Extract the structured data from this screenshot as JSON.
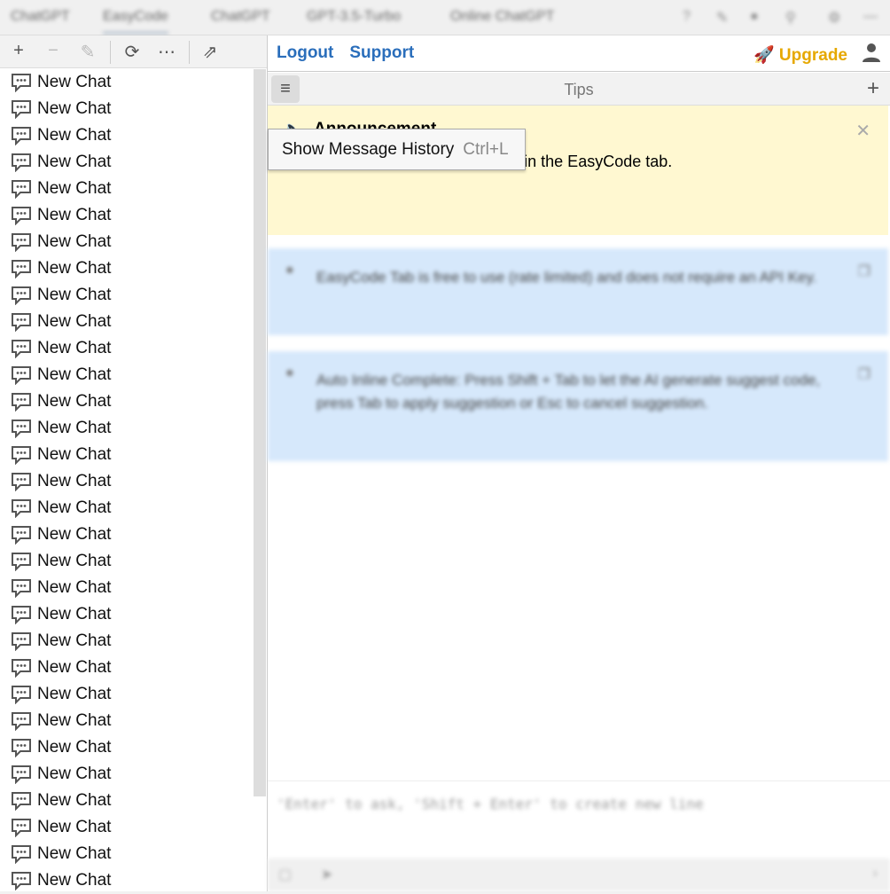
{
  "tabs": [
    "ChatGPT",
    "EasyCode",
    "ChatGPT",
    "GPT-3.5-Turbo",
    "Online ChatGPT"
  ],
  "header": {
    "logout": "Logout",
    "support": "Support",
    "upgrade": "Upgrade"
  },
  "tips_title": "Tips",
  "announcement": {
    "title": "Announcement",
    "body": "Paid plans are now available in the EasyCode tab."
  },
  "tips": [
    "EasyCode Tab is free to use (rate limited) and does not require an API Key.",
    "Auto Inline Complete: Press Shift + Tab to let the AI generate suggest code, press Tab to apply suggestion or Esc to cancel suggestion."
  ],
  "input_placeholder": "'Enter' to ask, 'Shift + Enter' to create new line",
  "tooltip": {
    "label": "Show Message History",
    "shortcut": "Ctrl+L"
  },
  "chat_label": "New Chat",
  "chat_count": 31,
  "colors": {
    "link": "#2a6ebb",
    "upgrade": "#e6a800",
    "announcement_bg": "#fff8d1",
    "tip_bg": "#d6e8fb"
  }
}
